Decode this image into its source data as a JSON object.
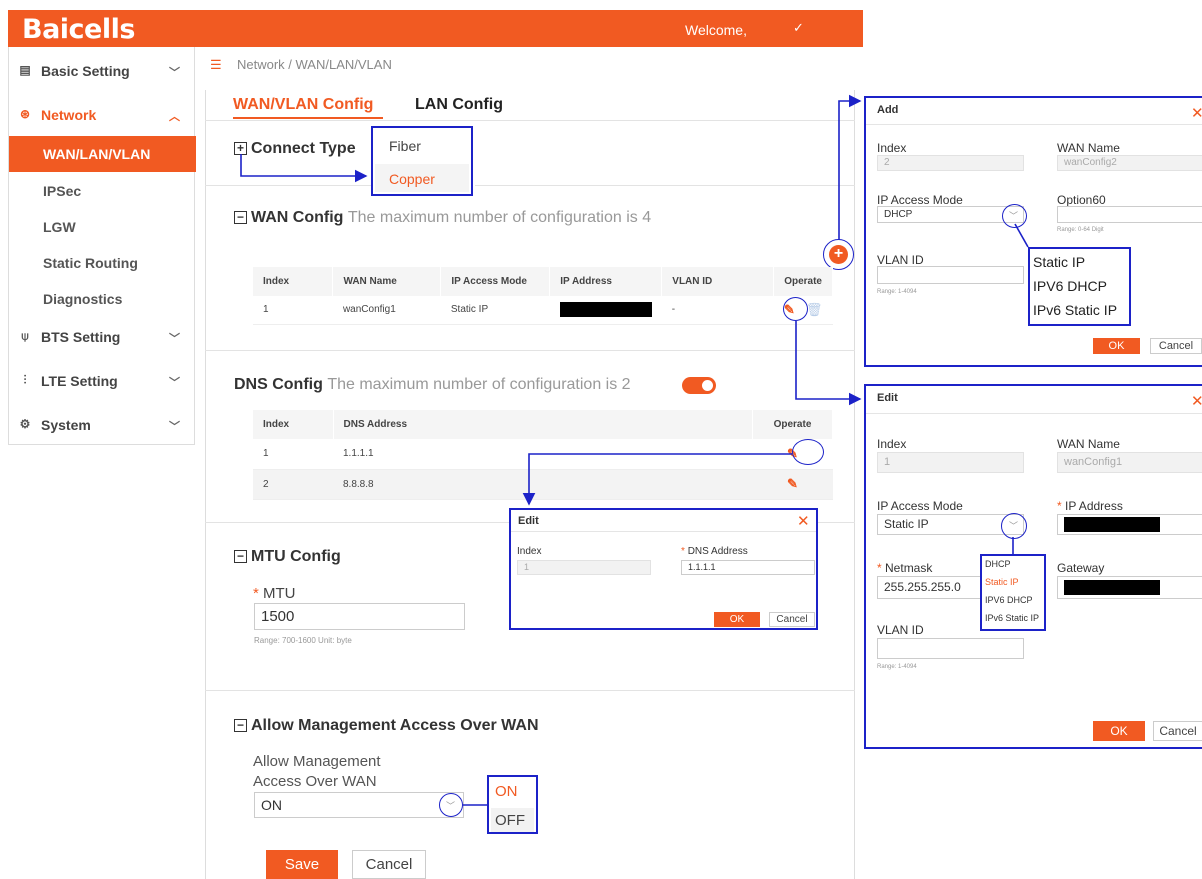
{
  "header": {
    "logo": "Baicells",
    "welcome": "Welcome,",
    "chevron": "✓"
  },
  "sidebar": {
    "items": [
      {
        "label": "Basic Setting",
        "icon": "document-icon"
      },
      {
        "label": "Network",
        "icon": "network-icon"
      },
      {
        "label": "WAN/LAN/VLAN"
      },
      {
        "label": "IPSec"
      },
      {
        "label": "LGW"
      },
      {
        "label": "Static Routing"
      },
      {
        "label": "Diagnostics"
      },
      {
        "label": "BTS Setting",
        "icon": "antenna-icon"
      },
      {
        "label": "LTE Setting",
        "icon": "lte-icon"
      },
      {
        "label": "System",
        "icon": "gear-icon"
      }
    ]
  },
  "breadcrumb": "Network / WAN/LAN/VLAN",
  "tabs": [
    {
      "label": "WAN/VLAN Config"
    },
    {
      "label": "LAN Config"
    }
  ],
  "connect_type": {
    "title": "Connect Type",
    "options": [
      "Fiber",
      "Copper"
    ]
  },
  "wan_config": {
    "title": "WAN Config",
    "hint": "The maximum number of configuration is 4",
    "columns": [
      "Index",
      "WAN Name",
      "IP Access Mode",
      "IP Address",
      "VLAN ID",
      "Operate"
    ],
    "rows": [
      {
        "index": "1",
        "name": "wanConfig1",
        "mode": "Static IP",
        "vlan": "-"
      }
    ]
  },
  "dns_config": {
    "title": "DNS Config",
    "hint": "The maximum number of configuration is 2",
    "columns": [
      "Index",
      "DNS Address",
      "Operate"
    ],
    "rows": [
      {
        "index": "1",
        "address": "1.1.1.1"
      },
      {
        "index": "2",
        "address": "8.8.8.8"
      }
    ]
  },
  "mtu_config": {
    "title": "MTU Config",
    "label": "MTU",
    "value": "1500",
    "hint": "Range: 700-1600 Unit: byte"
  },
  "mgmt_access": {
    "title": "Allow Management Access Over WAN",
    "label_line1": "Allow Management",
    "label_line2": "Access Over WAN",
    "value": "ON",
    "options": [
      "ON",
      "OFF"
    ]
  },
  "buttons": {
    "save": "Save",
    "cancel": "Cancel"
  },
  "dns_edit_dialog": {
    "title": "Edit",
    "index_label": "Index",
    "index_value": "1",
    "dns_label": "DNS Address",
    "dns_value": "1.1.1.1",
    "ok": "OK",
    "cancel": "Cancel"
  },
  "add_dialog": {
    "title": "Add",
    "index_label": "Index",
    "index_value": "2",
    "wan_name_label": "WAN Name",
    "wan_name_value": "wanConfig2",
    "mode_label": "IP Access Mode",
    "mode_value": "DHCP",
    "option60_label": "Option60",
    "option60_hint": "Range: 0-64 Digit",
    "vlan_label": "VLAN ID",
    "vlan_hint": "Range: 1-4094",
    "mode_options": [
      "Static IP",
      "IPV6 DHCP",
      "IPv6 Static IP"
    ],
    "ok": "OK",
    "cancel": "Cancel"
  },
  "wan_edit_dialog": {
    "title": "Edit",
    "index_label": "Index",
    "index_value": "1",
    "wan_name_label": "WAN Name",
    "wan_name_value": "wanConfig1",
    "mode_label": "IP Access Mode",
    "mode_value": "Static IP",
    "ip_label": "IP Address",
    "netmask_label": "Netmask",
    "netmask_value": "255.255.255.0",
    "gateway_label": "Gateway",
    "vlan_label": "VLAN ID",
    "vlan_hint": "Range: 1-4094",
    "mode_options": [
      "DHCP",
      "Static IP",
      "IPV6 DHCP",
      "IPv6 Static IP"
    ],
    "ok": "OK",
    "cancel": "Cancel"
  },
  "colors": {
    "accent": "#f15a22",
    "annotation": "#1c22c8"
  }
}
